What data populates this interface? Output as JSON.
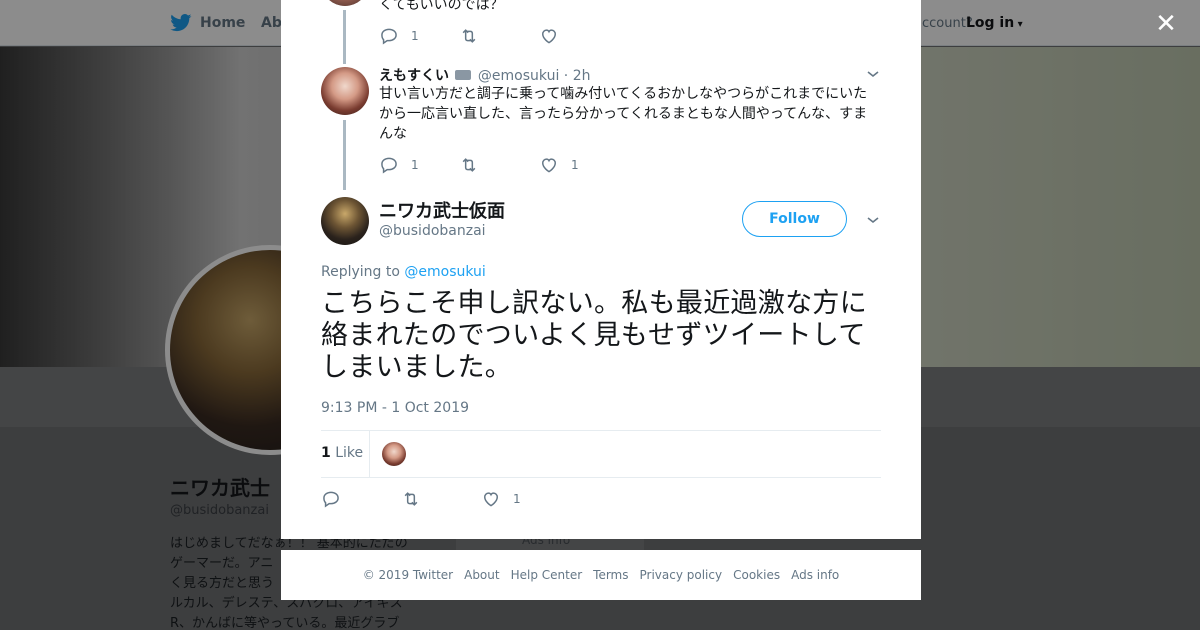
{
  "background": {
    "nav": {
      "home": "Home",
      "about": "Abo",
      "account_prompt": "ccount?",
      "login": "Log in"
    },
    "profile": {
      "name": "ニワカ武士",
      "handle": "@busidobanzai",
      "bio_lines": [
        "はじめましてだなぁ！！ 基本的にただの",
        "ゲーマーだ。アニ",
        "く見る方だと思う",
        "ルカル、デレステ、スパクロ、アイギス",
        "R、かんばに等やっている。最近グラブ"
      ],
      "card_text": "Ads info"
    }
  },
  "modal": {
    "close_symbol": "✕",
    "tweets": [
      {
        "text": "くてもいいのでは？",
        "replies": "1",
        "likes": ""
      },
      {
        "name": "えもすくい",
        "handle": "@emosukui",
        "time": "2h",
        "text": "甘い言い方だと調子に乗って噛み付いてくるおかしなやつらがこれまでにいたから一応言い直した、言ったら分かってくれるまともな人間やってんな、すまんな",
        "replies": "1",
        "likes": "1"
      }
    ],
    "main_tweet": {
      "name": "ニワカ武士仮面",
      "handle": "@busidobanzai",
      "follow_label": "Follow",
      "replying_prefix": "Replying to",
      "replying_to": "@emosukui",
      "text": "こちらこそ申し訳ない。私も最近過激な方に絡まれたのでついよく見もせずツイートしてしまいました。",
      "timestamp": "9:13 PM - 1 Oct 2019",
      "like_count": "1",
      "like_label": "Like",
      "action_likes": "1"
    }
  },
  "footer": {
    "links": [
      "© 2019 Twitter",
      "About",
      "Help Center",
      "Terms",
      "Privacy policy",
      "Cookies",
      "Ads info"
    ]
  },
  "colors": {
    "accent": "#1da1f2",
    "muted": "#657786",
    "thread_line": "#aab8c2"
  }
}
